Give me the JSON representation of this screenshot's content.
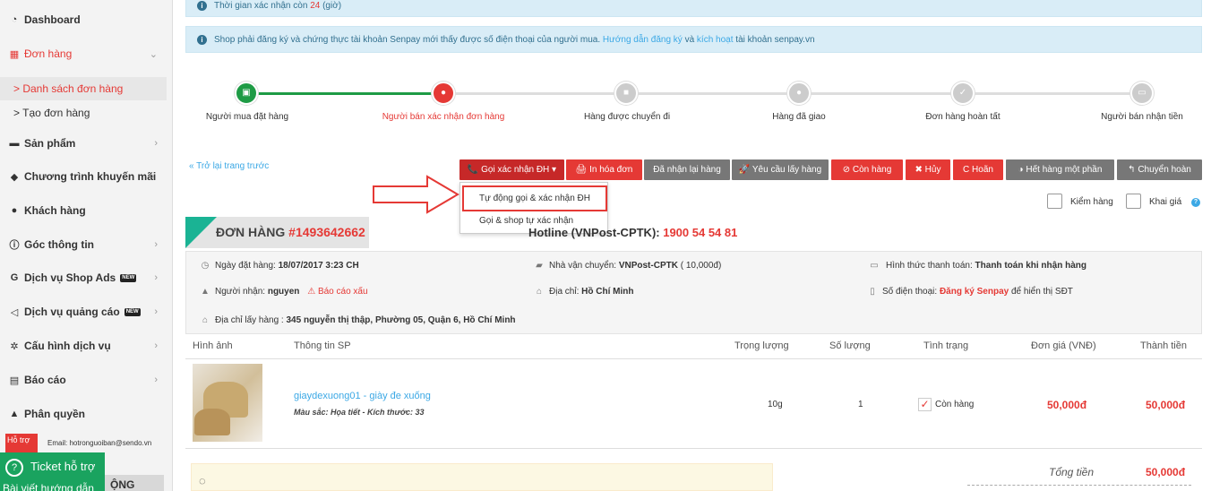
{
  "sidebar": {
    "items": [
      {
        "label": "Dashboard",
        "icon": "dashboard-icon"
      },
      {
        "label": "Đơn hàng",
        "icon": "table-icon"
      },
      {
        "label": "Sản phẩm",
        "icon": "product-icon"
      },
      {
        "label": "Chương trình khuyến mãi",
        "icon": "tag-icon"
      },
      {
        "label": "Khách hàng",
        "icon": "users-icon"
      },
      {
        "label": "Góc thông tin",
        "icon": "info-icon"
      },
      {
        "label": "Dịch vụ Shop Ads",
        "icon": "google-icon"
      },
      {
        "label": "Dịch vụ quảng cáo",
        "icon": "megaphone-icon"
      },
      {
        "label": "Cấu hình dịch vụ",
        "icon": "gear-icon"
      },
      {
        "label": "Báo cáo",
        "icon": "report-icon"
      },
      {
        "label": "Phân quyền",
        "icon": "user-icon"
      }
    ],
    "sub_items": [
      "> Danh sách đơn hàng",
      "> Tạo đơn hàng"
    ],
    "new_badge": "NEW",
    "support_badge": "Hỗ trợ",
    "support_email": "Email: hotronguoiban@sendo.vn",
    "ticket_label": "Ticket hỗ trợ",
    "guide_label": "Bài viết hướng dẫn",
    "bottom_label": "ỘNG ĐỒNG"
  },
  "alerts": {
    "confirm_time_prefix": "Thời gian xác nhận còn ",
    "confirm_time_value": "24",
    "confirm_time_suffix": " (giờ)",
    "senpay_text": "Shop phải đăng ký và chứng thực tài khoản Senpay mới thấy được số điện thoại của người mua. ",
    "senpay_link1": "Hướng dẫn đăng ký",
    "senpay_and": " và ",
    "senpay_link2": "kích hoạt",
    "senpay_tail": " tài khoản senpay.vn"
  },
  "progress": {
    "steps": [
      "Người mua đặt hàng",
      "Người bán xác nhận đơn hàng",
      "Hàng được chuyển đi",
      "Hàng đã giao",
      "Đơn hàng hoàn tất",
      "Người bán nhận tiền"
    ],
    "colors": {
      "done": "#1e9b45",
      "current": "#e53935",
      "pending": "#cccccc"
    }
  },
  "toolbar": {
    "back": "« Trở lại trang trước",
    "call_confirm": "📞 Gọi xác nhận ĐH ▾",
    "print": "🖨 In hóa đơn",
    "received_back": "Đã nhận lại hàng",
    "request_pickup": "🚀 Yêu cầu lấy hàng",
    "in_stock": "⊘ Còn hàng",
    "cancel": "✖ Hủy",
    "refund": "C Hoãn",
    "partial_out": "◑ Hết hàng một phần",
    "transfer": "↰ Chuyển hoàn"
  },
  "dropdown": {
    "auto_call": "Tự động gọi & xác nhận ĐH",
    "shop_call": "Gọi & shop tự xác nhận"
  },
  "checks": {
    "inspect": "Kiểm hàng",
    "declare": "Khai giá"
  },
  "order": {
    "title_prefix": "ĐƠN HÀNG ",
    "number": "#1493642662",
    "hotline_prefix": "Hotline (VNPost-CPTK): ",
    "hotline_number": "1900 54 54 81",
    "date_label": "Ngày đặt hàng: ",
    "date_value": "18/07/2017 3:23 CH",
    "carrier_label": "Nhà vận chuyển: ",
    "carrier_value": "VNPost-CPTK",
    "carrier_fee": " ( 10,000đ)",
    "payment_label": "Hình thức thanh toán: ",
    "payment_value": "Thanh toán khi nhận hàng",
    "receiver_label": "Người nhận: ",
    "receiver_value": "nguyen",
    "report_bad": "Báo cáo xấu",
    "address_label": "Địa chỉ: ",
    "address_value": "Hồ Chí Minh",
    "phone_label": "Số điện thoại: ",
    "phone_link": "Đăng ký Senpay",
    "phone_suffix": " để hiển thị SĐT",
    "pickup_label": "Địa chỉ lấy hàng : ",
    "pickup_value": "345 nguyễn thị thập, Phường 05, Quận 6, Hồ Chí Minh"
  },
  "table": {
    "headers": [
      "Hình ảnh",
      "Thông tin SP",
      "Trọng lượng",
      "Số lượng",
      "Tình trạng",
      "Đơn giá (VNĐ)",
      "Thành tiền"
    ],
    "row": {
      "name": "giaydexuong01 - giày đe xuống",
      "attrs": "Màu sắc: Họa tiết - Kích thước: 33",
      "weight": "10g",
      "qty": "1",
      "status": "Còn hàng",
      "unit_price": "50,000đ",
      "total": "50,000đ"
    },
    "total_label": "Tổng tiền",
    "total_value": "50,000đ"
  }
}
